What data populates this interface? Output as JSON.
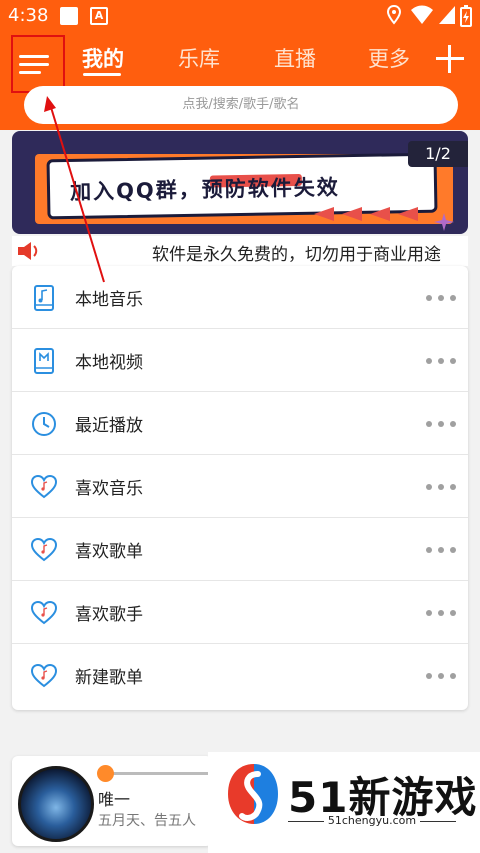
{
  "status_bar": {
    "time": "4:38",
    "badge_letter": "A"
  },
  "nav": {
    "tabs": [
      {
        "label": "我的",
        "active": true
      },
      {
        "label": "乐库",
        "active": false
      },
      {
        "label": "直播",
        "active": false
      },
      {
        "label": "更多",
        "active": false
      }
    ]
  },
  "search": {
    "placeholder": "点我/搜索/歌手/歌名"
  },
  "banner": {
    "text": "加入QQ群，预防软件失效",
    "counter": "1/2"
  },
  "notice": {
    "text": "软件是永久免费的，切勿用于商业用途"
  },
  "menu": {
    "items": [
      {
        "label": "本地音乐",
        "icon": "music-file-icon"
      },
      {
        "label": "本地视频",
        "icon": "video-file-icon"
      },
      {
        "label": "最近播放",
        "icon": "clock-icon"
      },
      {
        "label": "喜欢音乐",
        "icon": "heart-music-icon"
      },
      {
        "label": "喜欢歌单",
        "icon": "heart-music-icon"
      },
      {
        "label": "喜欢歌手",
        "icon": "heart-music-icon"
      },
      {
        "label": "新建歌单",
        "icon": "heart-music-icon"
      }
    ]
  },
  "player": {
    "song": "唯一",
    "artist": "五月天、告五人"
  },
  "watermark": {
    "brand": "51新游戏",
    "url": "51chengyu.com"
  },
  "colors": {
    "accent": "#ff5e0e",
    "icon_blue": "#2b8fe0",
    "annotation_red": "#e01010"
  }
}
